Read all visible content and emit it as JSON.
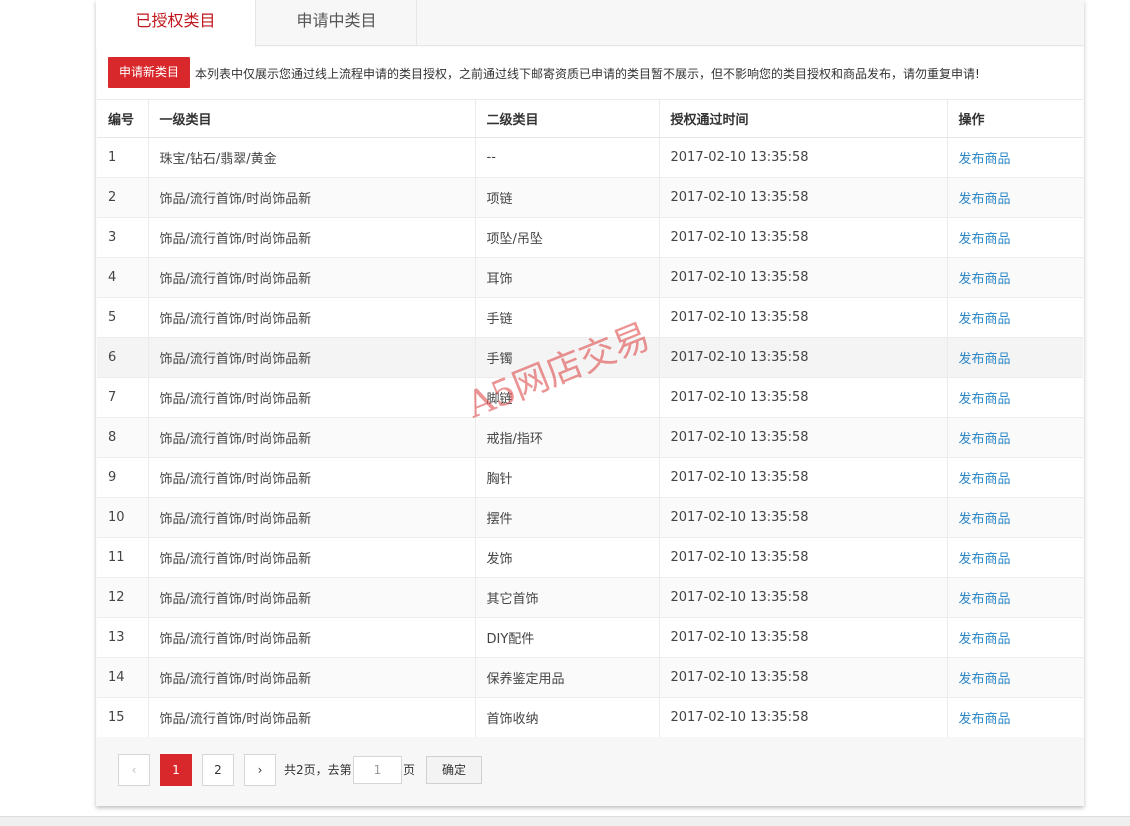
{
  "tabs": {
    "authorized": "已授权类目",
    "pending": "申请中类目"
  },
  "notice": {
    "apply_button": "申请新类目",
    "text": "本列表中仅展示您通过线上流程申请的类目授权，之前通过线下邮寄资质已申请的类目暂不展示，但不影响您的类目授权和商品发布，请勿重复申请!"
  },
  "table": {
    "headers": [
      "编号",
      "一级类目",
      "二级类目",
      "授权通过时间",
      "操作"
    ],
    "rows": [
      {
        "no": "1",
        "level1": "珠宝/钻石/翡翠/黄金",
        "level2": "--",
        "time": "2017-02-10 13:35:58",
        "action": "发布商品"
      },
      {
        "no": "2",
        "level1": "饰品/流行首饰/时尚饰品新",
        "level2": "项链",
        "time": "2017-02-10 13:35:58",
        "action": "发布商品"
      },
      {
        "no": "3",
        "level1": "饰品/流行首饰/时尚饰品新",
        "level2": "项坠/吊坠",
        "time": "2017-02-10 13:35:58",
        "action": "发布商品"
      },
      {
        "no": "4",
        "level1": "饰品/流行首饰/时尚饰品新",
        "level2": "耳饰",
        "time": "2017-02-10 13:35:58",
        "action": "发布商品"
      },
      {
        "no": "5",
        "level1": "饰品/流行首饰/时尚饰品新",
        "level2": "手链",
        "time": "2017-02-10 13:35:58",
        "action": "发布商品"
      },
      {
        "no": "6",
        "level1": "饰品/流行首饰/时尚饰品新",
        "level2": "手镯",
        "time": "2017-02-10 13:35:58",
        "action": "发布商品"
      },
      {
        "no": "7",
        "level1": "饰品/流行首饰/时尚饰品新",
        "level2": "脚链",
        "time": "2017-02-10 13:35:58",
        "action": "发布商品"
      },
      {
        "no": "8",
        "level1": "饰品/流行首饰/时尚饰品新",
        "level2": "戒指/指环",
        "time": "2017-02-10 13:35:58",
        "action": "发布商品"
      },
      {
        "no": "9",
        "level1": "饰品/流行首饰/时尚饰品新",
        "level2": "胸针",
        "time": "2017-02-10 13:35:58",
        "action": "发布商品"
      },
      {
        "no": "10",
        "level1": "饰品/流行首饰/时尚饰品新",
        "level2": "摆件",
        "time": "2017-02-10 13:35:58",
        "action": "发布商品"
      },
      {
        "no": "11",
        "level1": "饰品/流行首饰/时尚饰品新",
        "level2": "发饰",
        "time": "2017-02-10 13:35:58",
        "action": "发布商品"
      },
      {
        "no": "12",
        "level1": "饰品/流行首饰/时尚饰品新",
        "level2": "其它首饰",
        "time": "2017-02-10 13:35:58",
        "action": "发布商品"
      },
      {
        "no": "13",
        "level1": "饰品/流行首饰/时尚饰品新",
        "level2": "DIY配件",
        "time": "2017-02-10 13:35:58",
        "action": "发布商品"
      },
      {
        "no": "14",
        "level1": "饰品/流行首饰/时尚饰品新",
        "level2": "保养鉴定用品",
        "time": "2017-02-10 13:35:58",
        "action": "发布商品"
      },
      {
        "no": "15",
        "level1": "饰品/流行首饰/时尚饰品新",
        "level2": "首饰收纳",
        "time": "2017-02-10 13:35:58",
        "action": "发布商品"
      }
    ]
  },
  "pager": {
    "prev": "‹",
    "next": "›",
    "pages": [
      "1",
      "2"
    ],
    "current": "1",
    "total_text": "共2页，去第",
    "input_value": "1",
    "page_suffix": "页",
    "confirm": "确定"
  },
  "watermark": "A5网店交易"
}
